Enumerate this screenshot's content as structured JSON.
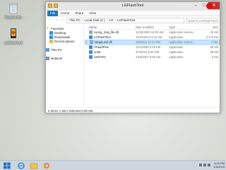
{
  "desktop": {
    "icons": [
      {
        "label": "Recycle Bin",
        "icon": "recycle-bin-icon"
      },
      {
        "label": "LGFlashTool",
        "icon": "lg-flash-tool-icon"
      }
    ]
  },
  "window": {
    "title": "LGFlashTool",
    "ribbon_tabs": [
      "File",
      "Home",
      "Share",
      "View"
    ],
    "address_path": [
      "This PC",
      "Local Disk (C:)",
      "LG",
      "LGFlashTool"
    ],
    "search_placeholder": "Search LGFlashTool"
  },
  "nav_pane": {
    "favorites_label": "Favorites",
    "favorites": [
      "Desktop",
      "Downloads",
      "Recent places"
    ],
    "this_pc_label": "This PC",
    "network_label": "Network"
  },
  "columns": {
    "name": "Name",
    "date": "Date modified",
    "type": "Type",
    "size": "Size"
  },
  "files": [
    {
      "name": "cuong_msg_file.dll",
      "date": "11/30/2000 12:00 AM",
      "type": "Application extens...",
      "size": "40 KB",
      "selected": false
    },
    {
      "name": "LGFlashTool",
      "date": "10/23/2014 9:42 AM",
      "type": "Application",
      "size": "3,470 KB",
      "selected": false
    },
    {
      "name": "MegaLock.dll",
      "date": "8/2/2011 11:10 PM",
      "type": "Application extens...",
      "size": "7 KB",
      "selected": true
    },
    {
      "name": "TFlashPlus",
      "date": "12/1/2005 5:26 PM",
      "type": "Application",
      "size": "55 KB",
      "selected": false
    },
    {
      "name": "unrar",
      "date": "3/7/2014 6:34 PM",
      "type": "Application",
      "size": "99 KB",
      "selected": false
    },
    {
      "name": "UnRAR3",
      "date": "1/19/2007 5:09 AM",
      "type": "Application",
      "size": "0 KB",
      "selected": false
    }
  ],
  "status_bar": "6 items    1 item selected  6.50 KB",
  "taskbar": {
    "apps": [
      "start-button",
      "ie-icon",
      "file-explorer-icon",
      "media-player-icon"
    ],
    "time": "4:19 PM",
    "date": "2/5/2015"
  },
  "colors": {
    "accent": "#1979ca",
    "selection": "#cce8ff",
    "close": "#c7302c"
  }
}
